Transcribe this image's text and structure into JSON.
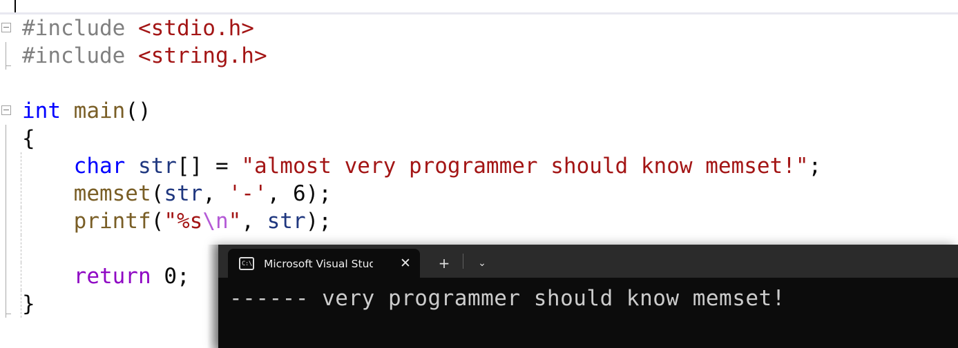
{
  "editor": {
    "caret_visible": true,
    "language": "c",
    "lines": [
      {
        "id": "include-stdio",
        "segments": [
          {
            "cls": "pp",
            "text": "#include "
          },
          {
            "cls": "str",
            "text": "<stdio.h>"
          }
        ]
      },
      {
        "id": "include-string",
        "segments": [
          {
            "cls": "pp",
            "text": "#include "
          },
          {
            "cls": "str",
            "text": "<string.h>"
          }
        ]
      },
      {
        "id": "blank-1",
        "segments": []
      },
      {
        "id": "int-main",
        "segments": [
          {
            "cls": "kw",
            "text": "int "
          },
          {
            "cls": "fn",
            "text": "main"
          },
          {
            "cls": "punc",
            "text": "()"
          }
        ]
      },
      {
        "id": "open-brace",
        "segments": [
          {
            "cls": "punc",
            "text": "{"
          }
        ]
      },
      {
        "id": "char-str-decl",
        "segments": [
          {
            "cls": "punc",
            "text": "    "
          },
          {
            "cls": "kw",
            "text": "char "
          },
          {
            "cls": "var",
            "text": "str"
          },
          {
            "cls": "punc",
            "text": "[] = "
          },
          {
            "cls": "str",
            "text": "\"almost very programmer should know memset!\""
          },
          {
            "cls": "punc",
            "text": ";"
          }
        ]
      },
      {
        "id": "memset-call",
        "segments": [
          {
            "cls": "punc",
            "text": "    "
          },
          {
            "cls": "fn",
            "text": "memset"
          },
          {
            "cls": "punc",
            "text": "("
          },
          {
            "cls": "var",
            "text": "str"
          },
          {
            "cls": "punc",
            "text": ", "
          },
          {
            "cls": "str",
            "text": "'-'"
          },
          {
            "cls": "punc",
            "text": ", "
          },
          {
            "cls": "num",
            "text": "6"
          },
          {
            "cls": "punc",
            "text": ");"
          }
        ]
      },
      {
        "id": "printf-call",
        "segments": [
          {
            "cls": "punc",
            "text": "    "
          },
          {
            "cls": "fn",
            "text": "printf"
          },
          {
            "cls": "punc",
            "text": "("
          },
          {
            "cls": "str",
            "text": "\"%s"
          },
          {
            "cls": "esc",
            "text": "\\n"
          },
          {
            "cls": "str",
            "text": "\""
          },
          {
            "cls": "punc",
            "text": ", "
          },
          {
            "cls": "var",
            "text": "str"
          },
          {
            "cls": "punc",
            "text": ");"
          }
        ]
      },
      {
        "id": "blank-2",
        "segments": []
      },
      {
        "id": "return-statement",
        "segments": [
          {
            "cls": "punc",
            "text": "    "
          },
          {
            "cls": "kw2",
            "text": "return "
          },
          {
            "cls": "num",
            "text": "0"
          },
          {
            "cls": "punc",
            "text": ";"
          }
        ]
      },
      {
        "id": "close-brace",
        "segments": [
          {
            "cls": "punc",
            "text": "}"
          }
        ]
      }
    ]
  },
  "terminal": {
    "tab": {
      "icon": "console-icon",
      "icon_glyph": "C:\\",
      "title": "Microsoft Visual Studio 调试控制台",
      "close_label": "✕"
    },
    "new_tab_label": "+",
    "dropdown_label": "⌄",
    "output_line": "------ very programmer should know memset!"
  },
  "colors": {
    "editor_background": "#ffffff",
    "terminal_background": "#0c0c0c",
    "tabbar_background": "#2b2b2b",
    "keyword": "#0000ff",
    "keyword_control": "#8f08c4",
    "function": "#795e26",
    "preprocessor": "#808080",
    "string": "#a31515",
    "escape": "#b45ad6",
    "identifier": "#1f377f",
    "punctuation": "#0a0a0a",
    "divider_rule": "#e8e8f0",
    "terminal_text": "#cccccc"
  }
}
